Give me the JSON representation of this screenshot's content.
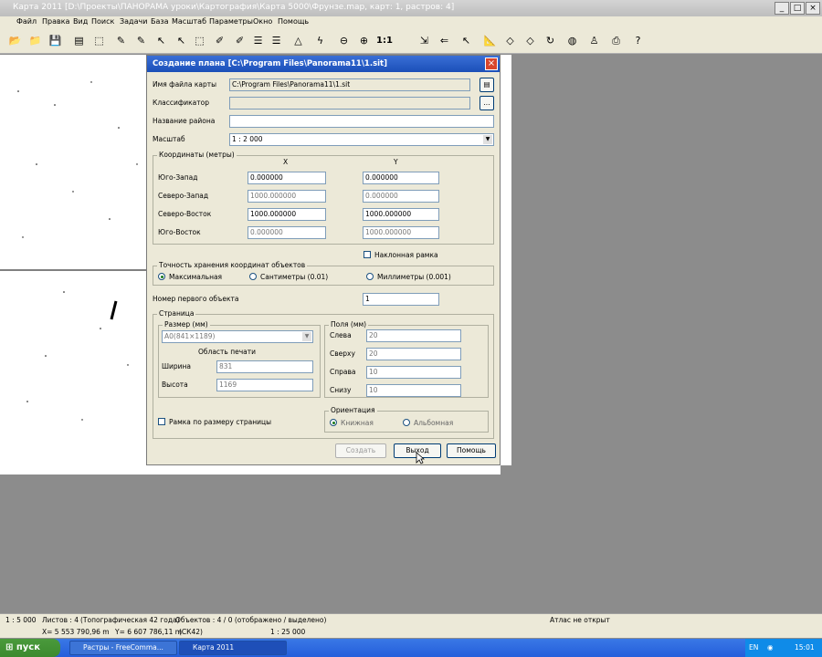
{
  "app": {
    "title": "Карта 2011   [D:\\Проекты\\ПАНОРАМА уроки\\Картография\\Карта 5000\\Фрунзе.map, карт: 1, растров: 4]"
  },
  "menu": [
    "Файл",
    "Правка",
    "Вид",
    "Поиск",
    "Задачи",
    "База",
    "Масштаб",
    "Параметры",
    "Окно",
    "Помощь"
  ],
  "toolbar": {
    "scale_label": "1:1"
  },
  "dialog": {
    "title": "Создание плана  [C:\\Program Files\\Panorama11\\1.sit]",
    "map_file_label": "Имя файла карты",
    "map_file_value": "C:\\Program Files\\Panorama11\\1.sit",
    "classifier_label": "Классификатор",
    "classifier_value": "",
    "region_label": "Название района",
    "region_value": "",
    "scale_label": "Масштаб",
    "scale_value": "1 : 2 000",
    "coords": {
      "group_title": "Координаты (метры)",
      "x_header": "X",
      "y_header": "Y",
      "rows": [
        {
          "label": "Юго-Запад",
          "x": "0.000000",
          "y": "0.000000"
        },
        {
          "label": "Северо-Запад",
          "x": "1000.000000",
          "y": "0.000000"
        },
        {
          "label": "Северо-Восток",
          "x": "1000.000000",
          "y": "1000.000000"
        },
        {
          "label": "Юго-Восток",
          "x": "0.000000",
          "y": "1000.000000"
        }
      ],
      "inclined_label": "Наклонная рамка"
    },
    "precision": {
      "group_title": "Точность хранения координат объектов",
      "options": [
        "Максимальная",
        "Сантиметры (0.01)",
        "Миллиметры (0.001)"
      ]
    },
    "first_object_label": "Номер первого объекта",
    "first_object_value": "1",
    "page": {
      "group_title": "Страница",
      "size_group": "Размер (мм)",
      "size_value": "A0(841×1189)",
      "print_area": "Область печати",
      "width_label": "Ширина",
      "width_value": "831",
      "height_label": "Высота",
      "height_value": "1169",
      "margins_group": "Поля (мм)",
      "left_label": "Слева",
      "left_value": "20",
      "top_label": "Сверху",
      "top_value": "20",
      "right_label": "Справа",
      "right_value": "10",
      "bottom_label": "Снизу",
      "bottom_value": "10",
      "orientation_group": "Ориентация",
      "portrait": "Книжная",
      "landscape": "Альбомная",
      "frame_label": "Рамка по размеру страницы"
    },
    "buttons": {
      "create": "Создать",
      "exit": "Выход",
      "help": "Помощь"
    }
  },
  "status": {
    "scale": "1 : 5 000",
    "sheets": "Листов : 4",
    "type": "(Топографическая 42 года)",
    "objects": "Объектов : 4 / 0 (отображено / выделено)",
    "atlas": "Атлас не открыт",
    "x": "X= 5 553 790,96 m",
    "y": "Y= 6 607 786,11 m",
    "system": "(СК42)",
    "view_scale": "1 : 25 000"
  },
  "taskbar": {
    "start": "пуск",
    "tasks": [
      "Растры - FreeComma...",
      "Карта 2011"
    ],
    "lang": "EN",
    "time": "15:01"
  }
}
